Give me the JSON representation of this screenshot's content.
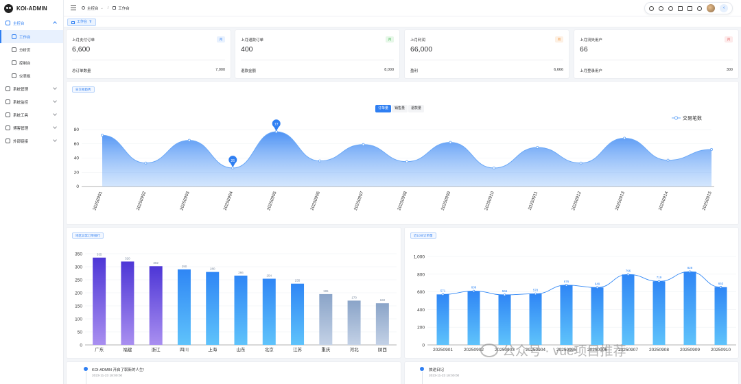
{
  "app": {
    "title": "KOI-ADMIN"
  },
  "sidebar": {
    "items": [
      {
        "label": "主控台",
        "icon": "home-icon",
        "open": true
      },
      {
        "label": "工作台",
        "icon": "monitor-icon",
        "sub": true,
        "active": true
      },
      {
        "label": "分析页",
        "icon": "analysis-icon",
        "sub": true
      },
      {
        "label": "控制台",
        "icon": "console-icon",
        "sub": true
      },
      {
        "label": "仪表板",
        "icon": "dashboard-icon",
        "sub": true
      },
      {
        "label": "系统管理",
        "icon": "settings-icon"
      },
      {
        "label": "系统监控",
        "icon": "monitor-screen-icon"
      },
      {
        "label": "系统工具",
        "icon": "tools-icon"
      },
      {
        "label": "博客管理",
        "icon": "blog-icon"
      },
      {
        "label": "外部链接",
        "icon": "link-icon"
      }
    ]
  },
  "header": {
    "breadcrumb": [
      "主控台",
      "工作台"
    ]
  },
  "tabs": [
    {
      "label": "工作台"
    }
  ],
  "stats": [
    {
      "title": "上月支付订单",
      "badge": "月",
      "badge_color": "#2f7ff2",
      "badge_bg": "#e8f1fe",
      "value": "6,600",
      "foot_label": "总订单数量",
      "foot_value": "7,000"
    },
    {
      "title": "上月退款订单",
      "badge": "月",
      "badge_color": "#3bb54a",
      "badge_bg": "#e6f7e8",
      "value": "400",
      "foot_label": "退款金额",
      "foot_value": "8,000"
    },
    {
      "title": "上月利润",
      "badge": "月",
      "badge_color": "#f08c2e",
      "badge_bg": "#fdf0e3",
      "value": "66,000",
      "foot_label": "盈利",
      "foot_value": "6,666"
    },
    {
      "title": "上月流失用户",
      "badge": "月",
      "badge_color": "#e05a5a",
      "badge_bg": "#fdeaea",
      "value": "66",
      "foot_label": "上月登录用户",
      "foot_value": "300"
    }
  ],
  "trend": {
    "chip": "日交易趋势",
    "segments": [
      "订单量",
      "销售量",
      "退款量"
    ],
    "legend": "交易笔数",
    "max_label": "77",
    "min_label": "26"
  },
  "region": {
    "chip": "地区异常订单排行"
  },
  "recent": {
    "chip": "近10日订单量"
  },
  "timeline": [
    {
      "text": "KOI-ADMIN 开启了崭新的人生!",
      "time": "2023-11-23 18:00:00"
    },
    {
      "text": "旅途日记",
      "time": "2023-11-23 18:00:00"
    }
  ],
  "watermark": {
    "text": "公众号 · vue项目推荐"
  },
  "chart_data": [
    {
      "type": "area",
      "x": [
        "20250901",
        "20250902",
        "20250903",
        "20250904",
        "20250905",
        "20250906",
        "20250907",
        "20250908",
        "20250909",
        "20250910",
        "20250911",
        "20250912",
        "20250913",
        "20250914",
        "20250915"
      ],
      "series": [
        {
          "name": "交易笔数",
          "values": [
            72,
            33,
            65,
            26,
            77,
            36,
            59,
            35,
            62,
            26,
            55,
            33,
            68,
            37,
            52
          ]
        }
      ],
      "ylim": [
        0,
        80
      ],
      "yticks": [
        0,
        20,
        40,
        60,
        80
      ],
      "color": "#2f7ff2"
    },
    {
      "type": "bar",
      "categories": [
        "广东",
        "福建",
        "浙江",
        "四川",
        "上海",
        "山东",
        "北京",
        "江苏",
        "重庆",
        "河北",
        "陕西"
      ],
      "values": [
        335,
        320,
        302,
        290,
        280,
        266,
        254,
        235,
        195,
        170,
        160
      ],
      "ylim": [
        0,
        350
      ],
      "yticks": [
        0,
        50,
        100,
        150,
        200,
        250,
        300,
        350
      ]
    },
    {
      "type": "bar",
      "categories": [
        "20250901",
        "20250902",
        "20250903",
        "20250904",
        "20250905",
        "20250906",
        "20250907",
        "20250908",
        "20250909",
        "20250910"
      ],
      "values": [
        571,
        609,
        566,
        578,
        676,
        649,
        796,
        719,
        828,
        653
      ],
      "ylim": [
        0,
        1000
      ],
      "yticks": [
        "0",
        "200",
        "400",
        "600",
        "800",
        "1,000"
      ],
      "line": true
    }
  ]
}
